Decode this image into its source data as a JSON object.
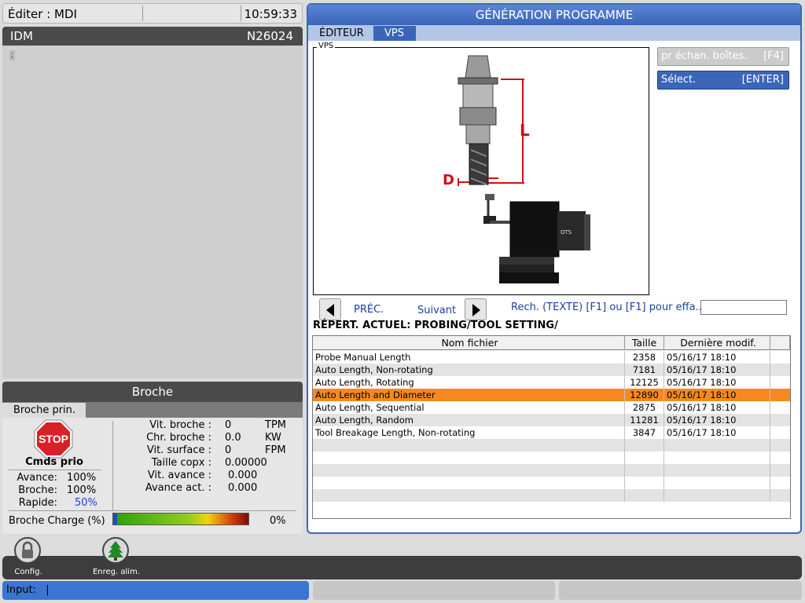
{
  "status": {
    "mode": "Éditer : MDI",
    "clock": "10:59:33"
  },
  "editor": {
    "title": "IDM",
    "program": "N26024",
    "cursor_glyph": ";"
  },
  "spindle": {
    "title": "Broche",
    "tab": "Broche prin.",
    "stop_text": "STOP",
    "cmds_title": "Cmds prio",
    "overrides": [
      {
        "label": "Avance:",
        "value": "100%"
      },
      {
        "label": "Broche:",
        "value": "100%"
      },
      {
        "label": "Rapide:",
        "value": "50%"
      }
    ],
    "stats": [
      {
        "label": "Vit. broche :",
        "value": "0",
        "unit": "TPM"
      },
      {
        "label": "Chr. broche :",
        "value": "0.0",
        "unit": "KW"
      },
      {
        "label": "Vit. surface :",
        "value": "0",
        "unit": "FPM"
      },
      {
        "label": "Taille copx :",
        "value": "0.00000",
        "unit": ""
      },
      {
        "label": "Vit. avance :",
        "value": "0.000",
        "unit": ""
      },
      {
        "label": "Avance act. :",
        "value": "0.000",
        "unit": ""
      }
    ],
    "load_label": "Broche Charge (%)",
    "load_pct": "0%",
    "load_value": 0
  },
  "program_gen": {
    "title": "GÉNÉRATION PROGRAMME",
    "tabs": [
      "ÉDITEUR",
      "VPS"
    ],
    "vps_label": "VPS",
    "diagram_labels": {
      "length": "L",
      "diameter": "D",
      "brand": "OTS"
    },
    "probe_button": {
      "label": "pr échan. boîtes.",
      "key": "[F4]"
    },
    "select_button": {
      "label": "Sélect.",
      "key": "[ENTER]"
    },
    "prev_label": "PRÉC.",
    "next_label": "Suivant",
    "search_hint": "Rech. (TEXTE) [F1] ou [F1] pour effa...",
    "search_value": "",
    "current_dir": "RÉPERT. ACTUEL: PROBING/TOOL SETTING/",
    "columns": [
      "Nom fichier",
      "Taille",
      "Dernière modif."
    ],
    "files": [
      {
        "name": "Probe Manual Length",
        "size": "2358",
        "date": "05/16/17 18:10"
      },
      {
        "name": "Auto Length, Non-rotating",
        "size": "7181",
        "date": "05/16/17 18:10"
      },
      {
        "name": "Auto Length, Rotating",
        "size": "12125",
        "date": "05/16/17 18:10"
      },
      {
        "name": "Auto Length and Diameter",
        "size": "12890",
        "date": "05/16/17 18:10"
      },
      {
        "name": "Auto Length, Sequential",
        "size": "2875",
        "date": "05/16/17 18:10"
      },
      {
        "name": "Auto Length, Random",
        "size": "11281",
        "date": "05/16/17 18:10"
      },
      {
        "name": "Tool Breakage Length, Non-rotating",
        "size": "3847",
        "date": "05/16/17 18:10"
      }
    ],
    "selected_index": 3
  },
  "bottom": {
    "config_label": "Config.",
    "power_label": "Enreg. alim.",
    "input_label": "Input:",
    "input_value": "|"
  },
  "colors": {
    "accent": "#3a65b8",
    "selected_row": "#f5891f",
    "stop": "#d8202a"
  }
}
